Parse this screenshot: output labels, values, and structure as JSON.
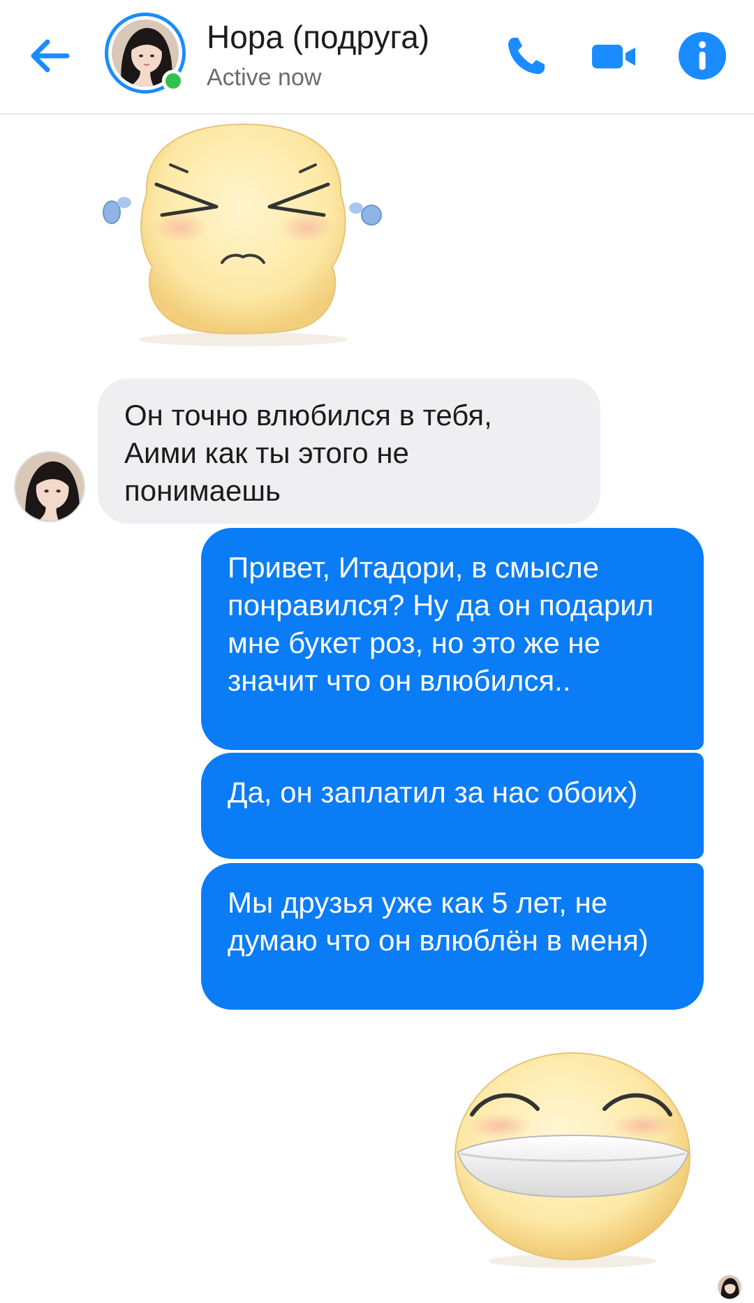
{
  "header": {
    "contact_name": "Нора (подруга)",
    "status": "Active now",
    "back_icon": "arrow-left-icon",
    "call_icon": "phone-icon",
    "video_icon": "video-camera-icon",
    "info_icon": "info-icon",
    "accent_color": "#1a8cff",
    "online_color": "#31c24d"
  },
  "messages": [
    {
      "type": "sticker",
      "direction": "incoming",
      "sticker": "crying-squint-emoji-sticker"
    },
    {
      "type": "text",
      "direction": "incoming",
      "text": "Он точно влюбился в тебя, Аими как ты этого не понимаешь"
    },
    {
      "type": "text",
      "direction": "outgoing",
      "text": "Привет, Итадори, в смысле понравился? Ну да он подарил мне букет роз, но это же не значит что он влюбился.."
    },
    {
      "type": "text",
      "direction": "outgoing",
      "text": "Да, он заплатил за нас обоих)"
    },
    {
      "type": "text",
      "direction": "outgoing",
      "text": "Мы друзья уже как 5 лет, не думаю что он влюблён в меня)"
    },
    {
      "type": "sticker",
      "direction": "outgoing",
      "sticker": "laughing-grin-emoji-sticker"
    }
  ],
  "colors": {
    "incoming_bubble": "#efeff1",
    "outgoing_bubble": "#0a7cf5"
  }
}
